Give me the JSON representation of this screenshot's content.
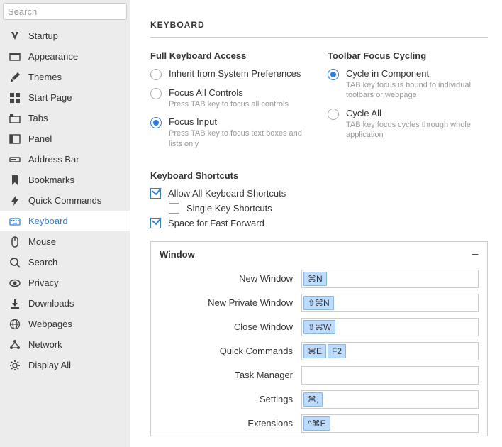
{
  "search": {
    "placeholder": "Search"
  },
  "sidebar": {
    "items": [
      {
        "label": "Startup",
        "icon": "vivaldi",
        "active": false
      },
      {
        "label": "Appearance",
        "icon": "window",
        "active": false
      },
      {
        "label": "Themes",
        "icon": "brush",
        "active": false
      },
      {
        "label": "Start Page",
        "icon": "grid",
        "active": false
      },
      {
        "label": "Tabs",
        "icon": "tabs",
        "active": false
      },
      {
        "label": "Panel",
        "icon": "panel",
        "active": false
      },
      {
        "label": "Address Bar",
        "icon": "address",
        "active": false
      },
      {
        "label": "Bookmarks",
        "icon": "bookmark",
        "active": false
      },
      {
        "label": "Quick Commands",
        "icon": "bolt",
        "active": false
      },
      {
        "label": "Keyboard",
        "icon": "keyboard",
        "active": true
      },
      {
        "label": "Mouse",
        "icon": "mouse",
        "active": false
      },
      {
        "label": "Search",
        "icon": "search",
        "active": false
      },
      {
        "label": "Privacy",
        "icon": "eye",
        "active": false
      },
      {
        "label": "Downloads",
        "icon": "download",
        "active": false
      },
      {
        "label": "Webpages",
        "icon": "globe",
        "active": false
      },
      {
        "label": "Network",
        "icon": "network",
        "active": false
      },
      {
        "label": "Display All",
        "icon": "gear",
        "active": false
      }
    ]
  },
  "heading": "KEYBOARD",
  "full_access": {
    "title": "Full Keyboard Access",
    "options": [
      {
        "label": "Inherit from System Preferences",
        "desc": "",
        "selected": false
      },
      {
        "label": "Focus All Controls",
        "desc": "Press TAB key to focus all controls",
        "selected": false
      },
      {
        "label": "Focus Input",
        "desc": "Press TAB key to focus text boxes and lists only",
        "selected": true
      }
    ]
  },
  "toolbar_cycling": {
    "title": "Toolbar Focus Cycling",
    "options": [
      {
        "label": "Cycle in Component",
        "desc": "TAB key focus is bound to individual toolbars or webpage",
        "selected": true
      },
      {
        "label": "Cycle All",
        "desc": "TAB key focus cycles through whole application",
        "selected": false
      }
    ]
  },
  "shortcuts_section": {
    "title": "Keyboard Shortcuts",
    "checks": [
      {
        "label": "Allow All Keyboard Shortcuts",
        "checked": true,
        "indent": false
      },
      {
        "label": "Single Key Shortcuts",
        "checked": false,
        "indent": true
      },
      {
        "label": "Space for Fast Forward",
        "checked": true,
        "indent": false
      }
    ]
  },
  "group": {
    "title": "Window",
    "rows": [
      {
        "label": "New Window",
        "keys": [
          "⌘N"
        ]
      },
      {
        "label": "New Private Window",
        "keys": [
          "⇧⌘N"
        ]
      },
      {
        "label": "Close Window",
        "keys": [
          "⇧⌘W"
        ]
      },
      {
        "label": "Quick Commands",
        "keys": [
          "⌘E",
          "F2"
        ]
      },
      {
        "label": "Task Manager",
        "keys": []
      },
      {
        "label": "Settings",
        "keys": [
          "⌘,"
        ]
      },
      {
        "label": "Extensions",
        "keys": [
          "^⌘E"
        ]
      }
    ]
  }
}
